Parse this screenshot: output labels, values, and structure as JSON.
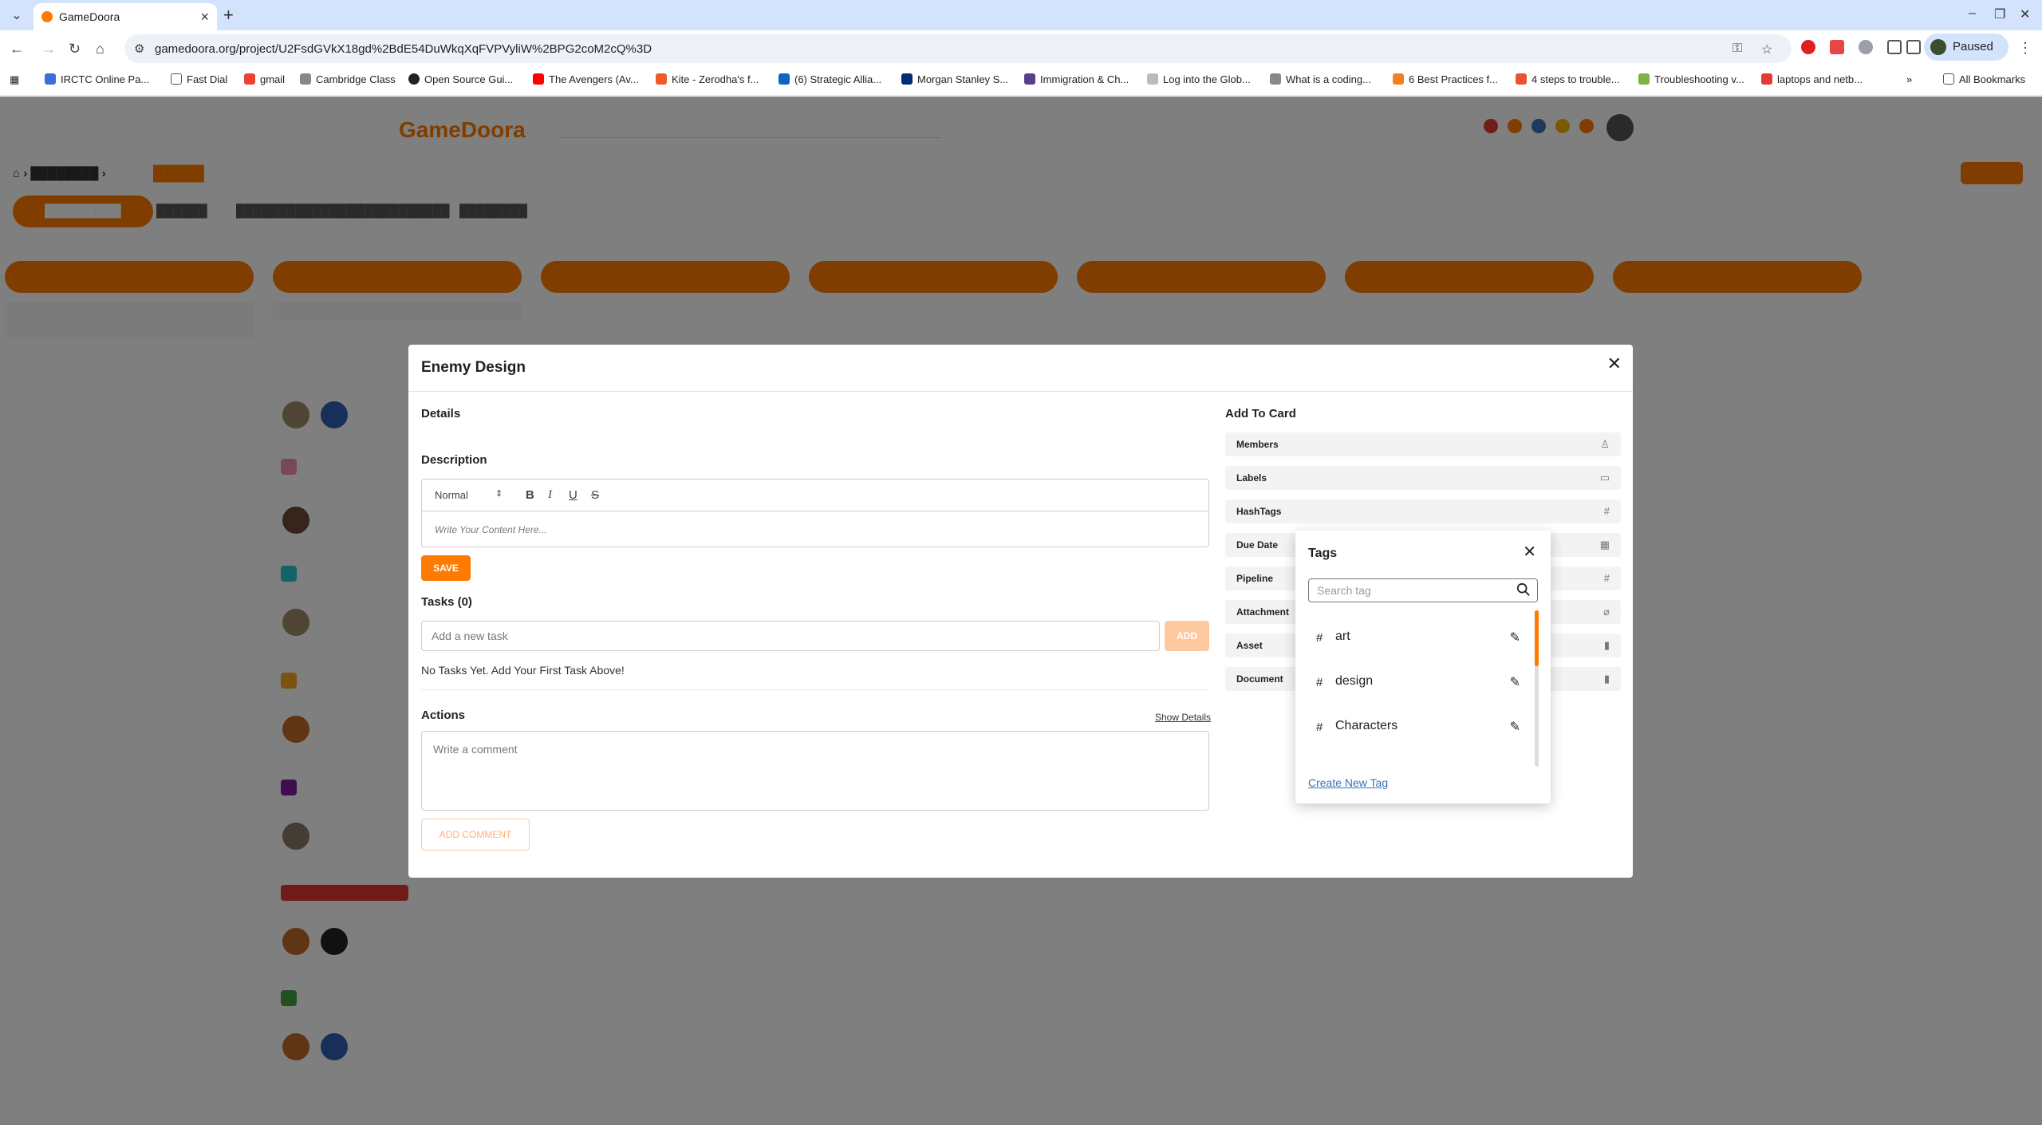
{
  "browser": {
    "tab_title": "GameDoora",
    "url": "gamedoora.org/project/U2FsdGVkX18gd%2BdE54DuWkqXqFVPVyliW%2BPG2coM2cQ%3D",
    "profile_status": "Paused",
    "bookmarks": [
      "IRCTC Online Pa...",
      "Fast Dial",
      "gmail",
      "Cambridge Class",
      "Open Source Gui...",
      "The Avengers (Av...",
      "Kite - Zerodha's f...",
      "(6) Strategic Allia...",
      "Morgan Stanley S...",
      "Immigration & Ch...",
      "Log into the Glob...",
      "What is a coding...",
      "6 Best Practices f...",
      "4 steps to trouble...",
      "Troubleshooting v...",
      "laptops and netb..."
    ],
    "all_bookmarks": "All Bookmarks"
  },
  "modal": {
    "title": "Enemy Design",
    "details_heading": "Details",
    "description_heading": "Description",
    "editor": {
      "format": "Normal",
      "bold": "B",
      "italic": "I",
      "underline": "U",
      "strike": "S",
      "placeholder": "Write Your Content Here..."
    },
    "save_label": "SAVE",
    "tasks_heading": "Tasks (0)",
    "task_placeholder": "Add a new task",
    "add_label": "ADD",
    "no_tasks": "No Tasks Yet. Add Your First Task Above!",
    "actions_heading": "Actions",
    "show_details": "Show Details",
    "comment_placeholder": "Write a comment",
    "add_comment": "ADD COMMENT",
    "add_to_card_heading": "Add To Card",
    "add_to_card": [
      {
        "label": "Members",
        "icon": "person-icon"
      },
      {
        "label": "Labels",
        "icon": "label-icon"
      },
      {
        "label": "HashTags",
        "icon": "hash-icon"
      },
      {
        "label": "Due Date",
        "icon": "calendar-icon"
      },
      {
        "label": "Pipeline",
        "icon": "hash-icon"
      },
      {
        "label": "Attachment",
        "icon": "paperclip-icon"
      },
      {
        "label": "Asset",
        "icon": "file-icon"
      },
      {
        "label": "Document",
        "icon": "file-icon"
      }
    ]
  },
  "tags_popover": {
    "title": "Tags",
    "search_placeholder": "Search tag",
    "tags": [
      {
        "hash": "#",
        "name": "art"
      },
      {
        "hash": "#",
        "name": "design"
      },
      {
        "hash": "#",
        "name": "Characters"
      }
    ],
    "create_label": "Create New Tag"
  },
  "colors": {
    "accent": "#ff7a00",
    "link": "#3b73b9"
  }
}
